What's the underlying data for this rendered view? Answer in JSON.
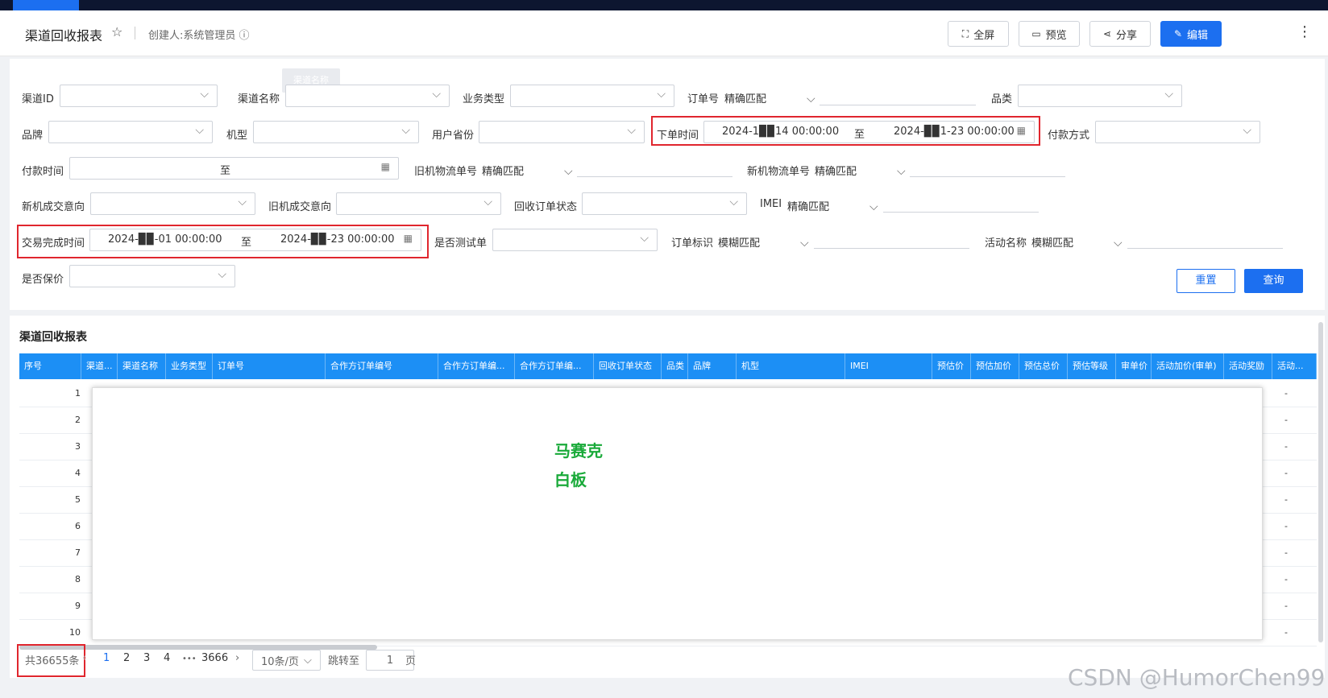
{
  "header": {
    "title": "渠道回收报表",
    "creator": "创建人:系统管理员 ⓘ",
    "buttons": {
      "fullscreen": "全屏",
      "preview": "预览",
      "share": "分享",
      "edit": "编辑"
    }
  },
  "tooltip": "渠道名称",
  "filters": {
    "channel_id": "渠道ID",
    "channel_name": "渠道名称",
    "biz_type": "业务类型",
    "order_no": "订单号",
    "order_no_match": "精确匹配",
    "category": "品类",
    "brand": "品牌",
    "model": "机型",
    "province": "用户省份",
    "order_time": "下单时间",
    "order_time_from": "2024-1▉▉14 00:00:00",
    "order_time_to": "2024-▉▉1-23 00:00:00",
    "range_sep": "至",
    "pay_method": "付款方式",
    "pay_time": "付款时间",
    "old_logistics": "旧机物流单号",
    "old_logistics_match": "精确匹配",
    "new_logistics": "新机物流单号",
    "new_logistics_match": "精确匹配",
    "new_intent": "新机成交意向",
    "old_intent": "旧机成交意向",
    "recycle_status": "回收订单状态",
    "imei": "IMEI",
    "imei_match": "精确匹配",
    "deal_time": "交易完成时间",
    "deal_time_from": "2024-▉▉-01 00:00:00",
    "deal_time_to": "2024-▉▉-23 00:00:00",
    "is_test": "是否测试单",
    "order_tag": "订单标识",
    "order_tag_match": "模糊匹配",
    "activity_name": "活动名称",
    "activity_name_match": "模糊匹配",
    "insured": "是否保价",
    "reset": "重置",
    "query": "查询"
  },
  "report": {
    "title": "渠道回收报表",
    "columns": [
      "序号",
      "渠道...",
      "渠道名称",
      "业务类型",
      "订单号",
      "合作方订单编号",
      "合作方订单编...",
      "合作方订单编...",
      "回收订单状态",
      "品类",
      "品牌",
      "机型",
      "IMEI",
      "预估价",
      "预估加价",
      "预估总价",
      "预估等级",
      "审单价",
      "活动加价(审单)",
      "活动奖励",
      "活动..."
    ],
    "rows": [
      "1",
      "2",
      "3",
      "4",
      "5",
      "6",
      "7",
      "8",
      "9",
      "10"
    ],
    "dash": "-"
  },
  "whiteboard": {
    "line1": "马赛克",
    "line2": "白板"
  },
  "pagination": {
    "total": "共36655条",
    "prev": "‹",
    "pages": [
      "1",
      "2",
      "3",
      "4"
    ],
    "ellipsis": "•••",
    "last": "3666",
    "next": "›",
    "page_size": "10条/页",
    "goto_label": "跳转至",
    "goto_value": "1",
    "page_suffix": "页"
  },
  "watermark": "CSDN @HumorChen99"
}
